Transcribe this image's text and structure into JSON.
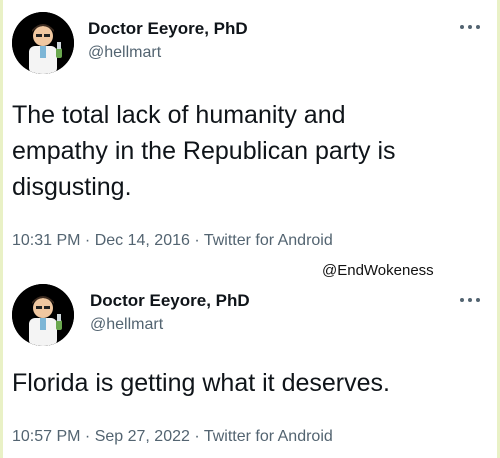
{
  "tweets": [
    {
      "display_name": "Doctor Eeyore, PhD",
      "handle": "@hellmart",
      "text_lines": [
        "The total lack of humanity and",
        "empathy in the Republican party is",
        "disgusting."
      ],
      "timestamp": "10:31 PM · Dec 14, 2016 · Twitter for Android",
      "avatar_icon": "scientist-avatar-icon",
      "more_icon": "more-options-icon"
    },
    {
      "display_name": "Doctor Eeyore, PhD",
      "handle": "@hellmart",
      "text_lines": [
        "Florida is getting what it deserves."
      ],
      "timestamp": "10:57 PM · Sep 27, 2022 · Twitter for Android",
      "avatar_icon": "scientist-avatar-icon",
      "more_icon": "more-options-icon"
    }
  ],
  "watermark": "@EndWokeness",
  "colors": {
    "text": "#0f1419",
    "secondary": "#536471",
    "border_tint": "#e9f1c6"
  }
}
